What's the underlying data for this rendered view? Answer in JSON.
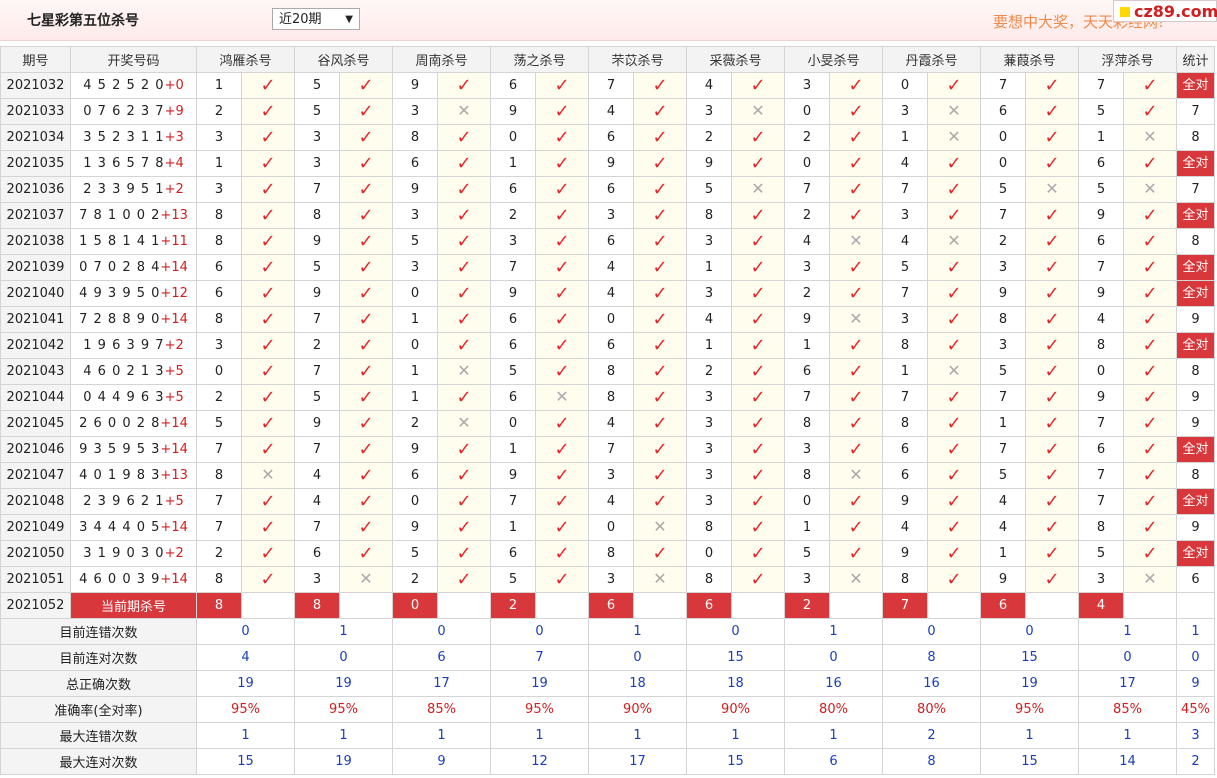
{
  "header": {
    "title": "七星彩第五位杀号",
    "period_select": "近20期",
    "slogan": "要想中大奖，天天彩经网!",
    "site": "cz89.com"
  },
  "columns": {
    "issue": "期号",
    "draw": "开奖号码",
    "experts": [
      "鸿雁杀号",
      "谷风杀号",
      "周南杀号",
      "荡之杀号",
      "芣苡杀号",
      "采薇杀号",
      "小旻杀号",
      "丹霞杀号",
      "蒹葭杀号",
      "浮萍杀号"
    ],
    "stat": "统计"
  },
  "rows": [
    {
      "issue": "2021032",
      "draw": "4 5 2 5 2 0",
      "sum": "+0",
      "kills": [
        1,
        5,
        9,
        6,
        7,
        4,
        3,
        0,
        7,
        7
      ],
      "ok": [
        1,
        1,
        1,
        1,
        1,
        1,
        1,
        1,
        1,
        1
      ],
      "stat": "全对"
    },
    {
      "issue": "2021033",
      "draw": "0 7 6 2 3 7",
      "sum": "+9",
      "kills": [
        2,
        5,
        3,
        9,
        4,
        3,
        0,
        3,
        6,
        5
      ],
      "ok": [
        1,
        1,
        0,
        1,
        1,
        0,
        1,
        0,
        1,
        1
      ],
      "stat": "7"
    },
    {
      "issue": "2021034",
      "draw": "3 5 2 3 1 1",
      "sum": "+3",
      "kills": [
        3,
        3,
        8,
        0,
        6,
        2,
        2,
        1,
        0,
        1
      ],
      "ok": [
        1,
        1,
        1,
        1,
        1,
        1,
        1,
        0,
        1,
        0
      ],
      "stat": "8"
    },
    {
      "issue": "2021035",
      "draw": "1 3 6 5 7 8",
      "sum": "+4",
      "kills": [
        1,
        3,
        6,
        1,
        9,
        9,
        0,
        4,
        0,
        6
      ],
      "ok": [
        1,
        1,
        1,
        1,
        1,
        1,
        1,
        1,
        1,
        1
      ],
      "stat": "全对"
    },
    {
      "issue": "2021036",
      "draw": "2 3 3 9 5 1",
      "sum": "+2",
      "kills": [
        3,
        7,
        9,
        6,
        6,
        5,
        7,
        7,
        5,
        5
      ],
      "ok": [
        1,
        1,
        1,
        1,
        1,
        0,
        1,
        1,
        0,
        0
      ],
      "stat": "7"
    },
    {
      "issue": "2021037",
      "draw": "7 8 1 0 0 2",
      "sum": "+13",
      "kills": [
        8,
        8,
        3,
        2,
        3,
        8,
        2,
        3,
        7,
        9
      ],
      "ok": [
        1,
        1,
        1,
        1,
        1,
        1,
        1,
        1,
        1,
        1
      ],
      "stat": "全对"
    },
    {
      "issue": "2021038",
      "draw": "1 5 8 1 4 1",
      "sum": "+11",
      "kills": [
        8,
        9,
        5,
        3,
        6,
        3,
        4,
        4,
        2,
        6
      ],
      "ok": [
        1,
        1,
        1,
        1,
        1,
        1,
        0,
        0,
        1,
        1
      ],
      "stat": "8"
    },
    {
      "issue": "2021039",
      "draw": "0 7 0 2 8 4",
      "sum": "+14",
      "kills": [
        6,
        5,
        3,
        7,
        4,
        1,
        3,
        5,
        3,
        7
      ],
      "ok": [
        1,
        1,
        1,
        1,
        1,
        1,
        1,
        1,
        1,
        1
      ],
      "stat": "全对"
    },
    {
      "issue": "2021040",
      "draw": "4 9 3 9 5 0",
      "sum": "+12",
      "kills": [
        6,
        9,
        0,
        9,
        4,
        3,
        2,
        7,
        9,
        9
      ],
      "ok": [
        1,
        1,
        1,
        1,
        1,
        1,
        1,
        1,
        1,
        1
      ],
      "stat": "全对"
    },
    {
      "issue": "2021041",
      "draw": "7 2 8 8 9 0",
      "sum": "+14",
      "kills": [
        8,
        7,
        1,
        6,
        0,
        4,
        9,
        3,
        8,
        4
      ],
      "ok": [
        1,
        1,
        1,
        1,
        1,
        1,
        0,
        1,
        1,
        1
      ],
      "stat": "9"
    },
    {
      "issue": "2021042",
      "draw": "1 9 6 3 9 7",
      "sum": "+2",
      "kills": [
        3,
        2,
        0,
        6,
        6,
        1,
        1,
        8,
        3,
        8
      ],
      "ok": [
        1,
        1,
        1,
        1,
        1,
        1,
        1,
        1,
        1,
        1
      ],
      "stat": "全对"
    },
    {
      "issue": "2021043",
      "draw": "4 6 0 2 1 3",
      "sum": "+5",
      "kills": [
        0,
        7,
        1,
        5,
        8,
        2,
        6,
        1,
        5,
        0
      ],
      "ok": [
        1,
        1,
        0,
        1,
        1,
        1,
        1,
        0,
        1,
        1
      ],
      "stat": "8"
    },
    {
      "issue": "2021044",
      "draw": "0 4 4 9 6 3",
      "sum": "+5",
      "kills": [
        2,
        5,
        1,
        6,
        8,
        3,
        7,
        7,
        7,
        9
      ],
      "ok": [
        1,
        1,
        1,
        0,
        1,
        1,
        1,
        1,
        1,
        1
      ],
      "stat": "9"
    },
    {
      "issue": "2021045",
      "draw": "2 6 0 0 2 8",
      "sum": "+14",
      "kills": [
        5,
        9,
        2,
        0,
        4,
        3,
        8,
        8,
        1,
        7
      ],
      "ok": [
        1,
        1,
        0,
        1,
        1,
        1,
        1,
        1,
        1,
        1
      ],
      "stat": "9"
    },
    {
      "issue": "2021046",
      "draw": "9 3 5 9 5 3",
      "sum": "+14",
      "kills": [
        7,
        7,
        9,
        1,
        7,
        3,
        3,
        6,
        7,
        6
      ],
      "ok": [
        1,
        1,
        1,
        1,
        1,
        1,
        1,
        1,
        1,
        1
      ],
      "stat": "全对"
    },
    {
      "issue": "2021047",
      "draw": "4 0 1 9 8 3",
      "sum": "+13",
      "kills": [
        8,
        4,
        6,
        9,
        3,
        3,
        8,
        6,
        5,
        7
      ],
      "ok": [
        0,
        1,
        1,
        1,
        1,
        1,
        0,
        1,
        1,
        1
      ],
      "stat": "8"
    },
    {
      "issue": "2021048",
      "draw": "2 3 9 6 2 1",
      "sum": "+5",
      "kills": [
        7,
        4,
        0,
        7,
        4,
        3,
        0,
        9,
        4,
        7
      ],
      "ok": [
        1,
        1,
        1,
        1,
        1,
        1,
        1,
        1,
        1,
        1
      ],
      "stat": "全对"
    },
    {
      "issue": "2021049",
      "draw": "3 4 4 4 0 5",
      "sum": "+14",
      "kills": [
        7,
        7,
        9,
        1,
        0,
        8,
        1,
        4,
        4,
        8
      ],
      "ok": [
        1,
        1,
        1,
        1,
        0,
        1,
        1,
        1,
        1,
        1
      ],
      "stat": "9"
    },
    {
      "issue": "2021050",
      "draw": "3 1 9 0 3 0",
      "sum": "+2",
      "kills": [
        2,
        6,
        5,
        6,
        8,
        0,
        5,
        9,
        1,
        5
      ],
      "ok": [
        1,
        1,
        1,
        1,
        1,
        1,
        1,
        1,
        1,
        1
      ],
      "stat": "全对"
    },
    {
      "issue": "2021051",
      "draw": "4 6 0 0 3 9",
      "sum": "+14",
      "kills": [
        8,
        3,
        2,
        5,
        3,
        8,
        3,
        8,
        9,
        3
      ],
      "ok": [
        1,
        0,
        1,
        1,
        0,
        1,
        0,
        1,
        1,
        0
      ],
      "stat": "6"
    }
  ],
  "current": {
    "issue": "2021052",
    "label": "当前期杀号",
    "kills": [
      "8",
      "8",
      "0",
      "2",
      "6",
      "6",
      "2",
      "7",
      "6",
      "4"
    ]
  },
  "summary": [
    {
      "label": "目前连错次数",
      "values": [
        "0",
        "1",
        "0",
        "0",
        "1",
        "0",
        "1",
        "0",
        "0",
        "1"
      ],
      "stat": "1",
      "red": false
    },
    {
      "label": "目前连对次数",
      "values": [
        "4",
        "0",
        "6",
        "7",
        "0",
        "15",
        "0",
        "8",
        "15",
        "0"
      ],
      "stat": "0",
      "red": false
    },
    {
      "label": "总正确次数",
      "values": [
        "19",
        "19",
        "17",
        "19",
        "18",
        "18",
        "16",
        "16",
        "19",
        "17"
      ],
      "stat": "9",
      "red": false
    },
    {
      "label": "准确率(全对率)",
      "values": [
        "95%",
        "95%",
        "85%",
        "95%",
        "90%",
        "90%",
        "80%",
        "80%",
        "95%",
        "85%"
      ],
      "stat": "45%",
      "red": true
    },
    {
      "label": "最大连错次数",
      "values": [
        "1",
        "1",
        "1",
        "1",
        "1",
        "1",
        "1",
        "2",
        "1",
        "1"
      ],
      "stat": "3",
      "red": false
    },
    {
      "label": "最大连对次数",
      "values": [
        "15",
        "19",
        "9",
        "12",
        "17",
        "15",
        "6",
        "8",
        "15",
        "14"
      ],
      "stat": "2",
      "red": false
    }
  ],
  "colors": {
    "accent": "#d8383b",
    "tick": "#e8262a",
    "blue": "#1a3fb5",
    "slogan": "#f08a4a"
  },
  "icons": {
    "tick": "check-icon",
    "cross": "cross-icon"
  }
}
